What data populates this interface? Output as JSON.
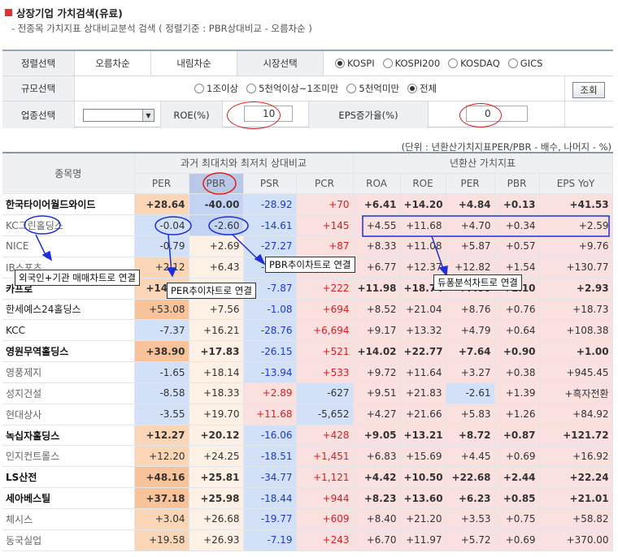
{
  "header": {
    "title": "상장기업 가치검색(유료)",
    "subtitle": "- 전종목 가치지표 상대비교분석 검색 ( 정렬기준 : PBR상대비교 - 오름차순 )"
  },
  "filters": {
    "sort_label": "정렬선택",
    "sort_asc": "오름차순",
    "sort_desc": "내림차순",
    "market_label": "시장선택",
    "markets": [
      {
        "label": "KOSPI",
        "selected": true
      },
      {
        "label": "KOSPI200",
        "selected": false
      },
      {
        "label": "KOSDAQ",
        "selected": false
      },
      {
        "label": "GICS",
        "selected": false
      }
    ],
    "size_label": "규모선택",
    "sizes": [
      {
        "label": "1조이상",
        "selected": false
      },
      {
        "label": "5천억이상~1조미만",
        "selected": false
      },
      {
        "label": "5천억미만",
        "selected": false
      },
      {
        "label": "전체",
        "selected": true
      }
    ],
    "industry_label": "업종선택",
    "industry_value": "",
    "roe_label": "ROE(%)",
    "roe_value": "10",
    "eps_label": "EPS증가율(%)",
    "eps_value": "0",
    "search_button": "조회"
  },
  "unit_note": "(단위 : 년환산가치지표PER/PBR - 배수, 나머지 - %)",
  "table": {
    "name_header": "종목명",
    "group1": "과거 최대치와 최저치 상대비교",
    "group2": "년환산 가치지표",
    "columns": [
      "PER",
      "PBR",
      "PSR",
      "PCR",
      "ROA",
      "ROE",
      "PER",
      "PBR",
      "EPS YoY"
    ],
    "rows": [
      {
        "name": "한국타이어월드와이드",
        "vals": [
          "+28.64",
          "-40.00",
          "-28.92",
          "+70",
          "+6.41",
          "+14.20",
          "+4.84",
          "+0.13",
          "+41.53"
        ]
      },
      {
        "name": "KC그린홀딩스",
        "vals": [
          "-0.04",
          "-2.60",
          "-14.61",
          "+145",
          "+4.55",
          "+11.68",
          "+4.70",
          "+0.34",
          "+2.59"
        ]
      },
      {
        "name": "NICE",
        "vals": [
          "-0.79",
          "+2.69",
          "-27.27",
          "+87",
          "+8.33",
          "+11.08",
          "+5.87",
          "+0.57",
          "+9.76"
        ]
      },
      {
        "name": "IB스포츠",
        "vals": [
          "+2.12",
          "+6.43",
          "-30.07",
          "+100",
          "+6.77",
          "+12.37",
          "+12.82",
          "+1.54",
          "+130.77"
        ]
      },
      {
        "name": "카프로",
        "vals": [
          "+14.95",
          "+7.21",
          "-7.87",
          "+222",
          "+11.98",
          "+18.74",
          "+7.00",
          "+1.10",
          "+2.93"
        ]
      },
      {
        "name": "한세예스24홀딩스",
        "vals": [
          "+53.08",
          "+7.56",
          "-1.08",
          "+694",
          "+8.52",
          "+21.04",
          "+8.76",
          "+0.76",
          "+18.73"
        ]
      },
      {
        "name": "KCC",
        "vals": [
          "-7.37",
          "+16.21",
          "-28.76",
          "+6,694",
          "+9.17",
          "+13.32",
          "+4.79",
          "+0.64",
          "+108.38"
        ]
      },
      {
        "name": "영원무역홀딩스",
        "vals": [
          "+38.90",
          "+17.83",
          "-26.15",
          "+521",
          "+14.02",
          "+22.77",
          "+7.64",
          "+0.90",
          "+1.00"
        ]
      },
      {
        "name": "영풍제지",
        "vals": [
          "-1.65",
          "+18.14",
          "-13.94",
          "+533",
          "+9.72",
          "+11.64",
          "+3.27",
          "+0.38",
          "+945.45"
        ]
      },
      {
        "name": "성지건설",
        "vals": [
          "-8.58",
          "+18.33",
          "+2.89",
          "-627",
          "+9.51",
          "+21.83",
          "-2.61",
          "+1.39",
          "+흑자전환"
        ]
      },
      {
        "name": "현대상사",
        "vals": [
          "-3.55",
          "+19.70",
          "+11.68",
          "-5,652",
          "+4.27",
          "+21.66",
          "+5.83",
          "+1.26",
          "+84.92"
        ]
      },
      {
        "name": "녹십자홀딩스",
        "vals": [
          "+12.27",
          "+20.12",
          "-16.06",
          "+428",
          "+9.05",
          "+13.21",
          "+8.72",
          "+0.87",
          "+121.72"
        ]
      },
      {
        "name": "인지컨트롤스",
        "vals": [
          "+12.20",
          "+24.25",
          "-18.51",
          "+1,451",
          "+6.83",
          "+15.69",
          "+4.45",
          "+0.69",
          "+16.92"
        ]
      },
      {
        "name": "LS산전",
        "vals": [
          "+48.16",
          "+25.81",
          "-34.77",
          "+1,121",
          "+4.42",
          "+10.50",
          "+22.68",
          "+2.44",
          "+22.24"
        ]
      },
      {
        "name": "세아베스틸",
        "vals": [
          "+37.18",
          "+25.98",
          "-18.44",
          "+944",
          "+8.23",
          "+13.60",
          "+6.23",
          "+0.85",
          "+21.01"
        ]
      },
      {
        "name": "체시스",
        "vals": [
          "+3.04",
          "+26.68",
          "-19.77",
          "+609",
          "+8.40",
          "+21.20",
          "+3.53",
          "+0.75",
          "+58.82"
        ]
      },
      {
        "name": "동국실업",
        "vals": [
          "+19.58",
          "+26.93",
          "-7.19",
          "+243",
          "+6.70",
          "+11.97",
          "+5.72",
          "+0.69",
          "+370.00"
        ]
      }
    ]
  },
  "annotations": {
    "foreign": "외국인+기관 매매차트로 연결",
    "per_chart": "PER추이차트로 연결",
    "pbr_chart": "PBR추이차트로 연결",
    "dupont": "듀퐁분석차트로 연결"
  }
}
